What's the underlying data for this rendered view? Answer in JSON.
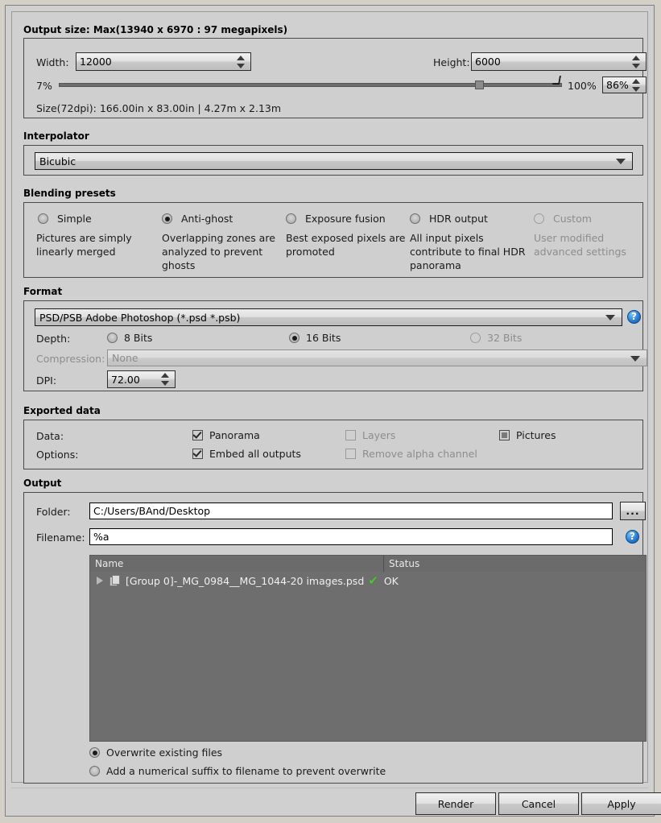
{
  "dialog": {
    "name": "export-render-settings"
  },
  "output_size": {
    "group_title": "Output size: Max(13940 x 6970 : 97 megapixels)",
    "width_label": "Width:",
    "width_value": "12000",
    "height_label": "Height:",
    "height_value": "6000",
    "slider_min_label": "7%",
    "slider_max_label": "100%",
    "percent_value": "86%",
    "size_info": "Size(72dpi): 166.00in x 83.00in |  4.27m x  2.13m"
  },
  "interpolator": {
    "group_title": "Interpolator",
    "value": "Bicubic"
  },
  "blending": {
    "group_title": "Blending presets",
    "presets": [
      {
        "label": "Simple",
        "desc": "Pictures are simply linearly merged",
        "selected": false,
        "disabled": false
      },
      {
        "label": "Anti-ghost",
        "desc": "Overlapping zones are analyzed to prevent ghosts",
        "selected": true,
        "disabled": false
      },
      {
        "label": "Exposure fusion",
        "desc": "Best exposed pixels are promoted",
        "selected": false,
        "disabled": false
      },
      {
        "label": "HDR output",
        "desc": "All input pixels contribute to final HDR panorama",
        "selected": false,
        "disabled": false
      },
      {
        "label": "Custom",
        "desc": "User modified advanced settings",
        "selected": false,
        "disabled": true
      }
    ]
  },
  "format": {
    "group_title": "Format",
    "format_value": "PSD/PSB Adobe Photoshop (*.psd *.psb)",
    "depth_label": "Depth:",
    "depth_options": [
      {
        "label": "8 Bits",
        "selected": false,
        "disabled": false
      },
      {
        "label": "16 Bits",
        "selected": true,
        "disabled": false
      },
      {
        "label": "32 Bits",
        "selected": false,
        "disabled": true
      }
    ],
    "compression_label": "Compression:",
    "compression_value": "None",
    "dpi_label": "DPI:",
    "dpi_value": "72.00",
    "help_icon": "help-icon"
  },
  "exported_data": {
    "group_title": "Exported data",
    "data_label": "Data:",
    "options_label": "Options:",
    "checkboxes": [
      {
        "label": "Panorama",
        "state": "checked",
        "disabled": false
      },
      {
        "label": "Layers",
        "state": "unchecked",
        "disabled": true
      },
      {
        "label": "Pictures",
        "state": "partial",
        "disabled": false
      },
      {
        "label": "Embed all outputs",
        "state": "checked",
        "disabled": false
      },
      {
        "label": "Remove alpha channel",
        "state": "unchecked",
        "disabled": true
      }
    ]
  },
  "output": {
    "group_title": "Output",
    "folder_label": "Folder:",
    "folder_value": "C:/Users/BAnd/Desktop",
    "browse_label": "...",
    "filename_label": "Filename:",
    "filename_value": "%a",
    "help_icon": "help-icon",
    "file_list": {
      "columns": [
        "Name",
        "Status"
      ],
      "rows": [
        {
          "name": "[Group 0]-_MG_0984__MG_1044-20 images.psd",
          "status": "OK",
          "status_icon": "check-icon"
        }
      ]
    },
    "overwrite_options": [
      {
        "label": "Overwrite existing files",
        "selected": true
      },
      {
        "label": "Add a numerical suffix to filename to prevent overwrite",
        "selected": false
      }
    ]
  },
  "buttons": {
    "render": "Render",
    "cancel": "Cancel",
    "apply": "Apply"
  },
  "colors": {
    "dialog_bg": "#d0d0d0",
    "group_border": "#4a4a4a",
    "list_bg": "#6e6e6e",
    "accent_blue": "#2a7fd4",
    "ok_green": "#4fc23a",
    "disabled_text": "#8d8d8d"
  }
}
